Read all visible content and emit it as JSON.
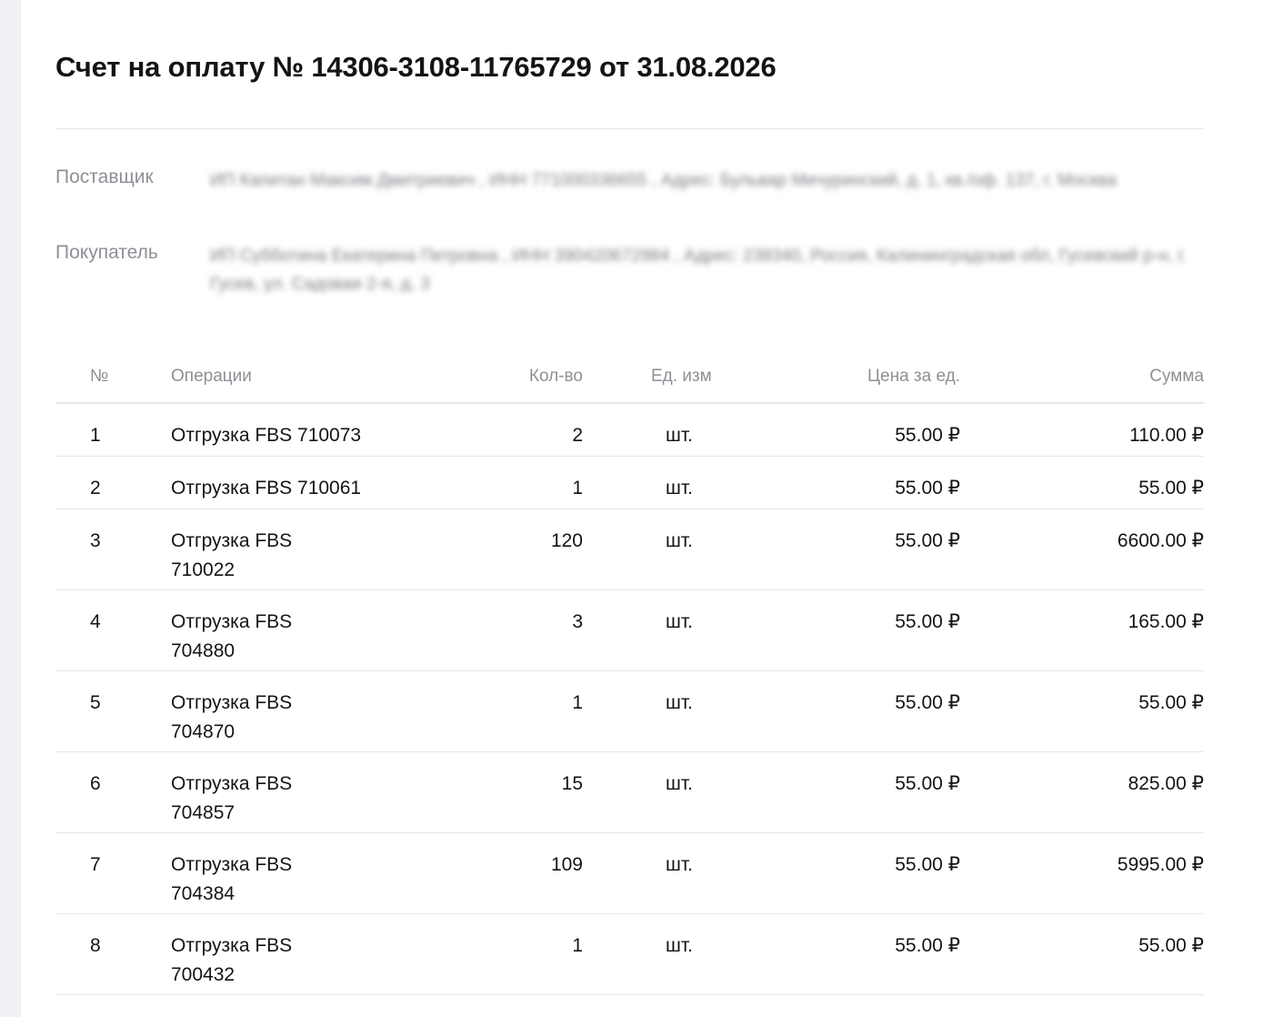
{
  "invoice": {
    "title": "Счет на оплату № 14306-3108-11765729 от 31.08.2026"
  },
  "parties": {
    "supplier_label": "Поставщик",
    "supplier_value": "ИП Капитан Максим Дмитриевич , ИНН 771000336655 , Адрес: Бульвар Мичуринский, д. 1, кв./оф. 137, г. Москва",
    "buyer_label": "Покупатель",
    "buyer_value": "ИП Субботина Екатерина Петровна , ИНН 390420672984 , Адрес: 238340, Россия, Калининградская обл, Гусевский р-н, г. Гусев, ул. Садовая 2-я, д. 3"
  },
  "table": {
    "headers": {
      "num": "№",
      "operation": "Операции",
      "qty": "Кол-во",
      "unit": "Ед. изм",
      "price": "Цена за ед.",
      "sum": "Сумма"
    },
    "rows": [
      {
        "num": "1",
        "operation": "Отгрузка FBS 710073",
        "qty": "2",
        "unit": "шт.",
        "price": "55.00 ₽",
        "sum": "110.00 ₽"
      },
      {
        "num": "2",
        "operation": "Отгрузка FBS 710061",
        "qty": "1",
        "unit": "шт.",
        "price": "55.00 ₽",
        "sum": "55.00 ₽"
      },
      {
        "num": "3",
        "operation": "Отгрузка FBS 710022",
        "qty": "120",
        "unit": "шт.",
        "price": "55.00 ₽",
        "sum": "6600.00 ₽"
      },
      {
        "num": "4",
        "operation": "Отгрузка FBS 704880",
        "qty": "3",
        "unit": "шт.",
        "price": "55.00 ₽",
        "sum": "165.00 ₽"
      },
      {
        "num": "5",
        "operation": "Отгрузка FBS 704870",
        "qty": "1",
        "unit": "шт.",
        "price": "55.00 ₽",
        "sum": "55.00 ₽"
      },
      {
        "num": "6",
        "operation": "Отгрузка FBS 704857",
        "qty": "15",
        "unit": "шт.",
        "price": "55.00 ₽",
        "sum": "825.00 ₽"
      },
      {
        "num": "7",
        "operation": "Отгрузка FBS 704384",
        "qty": "109",
        "unit": "шт.",
        "price": "55.00 ₽",
        "sum": "5995.00 ₽"
      },
      {
        "num": "8",
        "operation": "Отгрузка FBS 700432",
        "qty": "1",
        "unit": "шт.",
        "price": "55.00 ₽",
        "sum": "55.00 ₽"
      }
    ]
  }
}
